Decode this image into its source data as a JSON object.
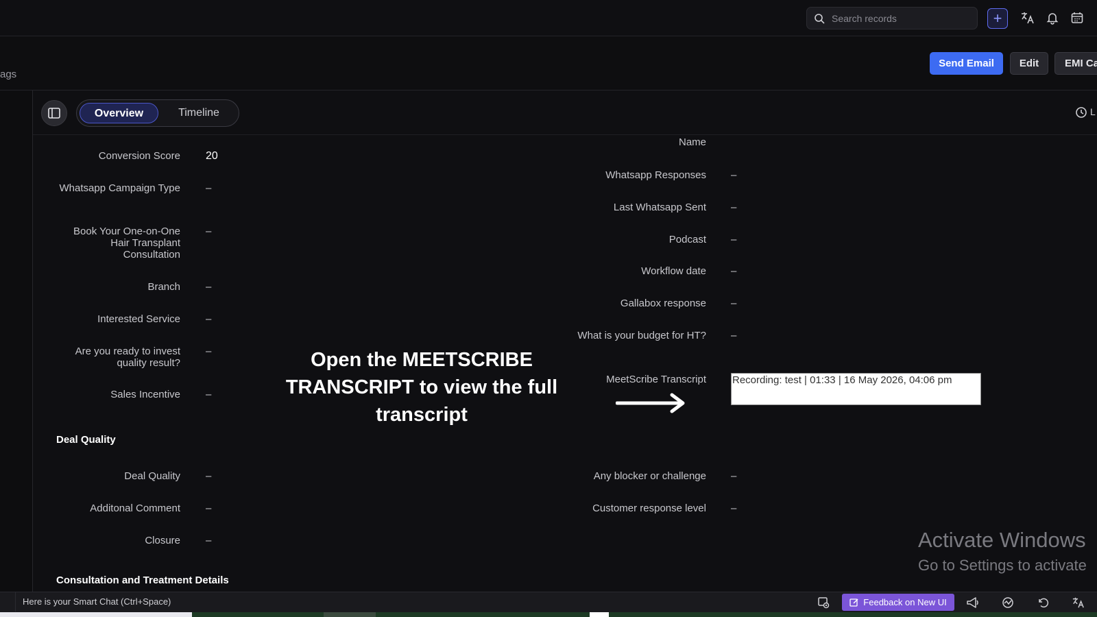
{
  "topbar": {
    "search_placeholder": "Search records",
    "add_label": "+"
  },
  "header": {
    "tags_label": "ags",
    "send_email": "Send Email",
    "edit": "Edit",
    "emi": "EMI Ca"
  },
  "tabs": {
    "overview": "Overview",
    "timeline": "Timeline",
    "clock_label": "L"
  },
  "left_fields": [
    {
      "label": "Conversion Score",
      "value": "20"
    },
    {
      "label": "Whatsapp Campaign Type",
      "value": "–"
    },
    {
      "label": "Book Your One-on-One Hair Transplant Consultation",
      "value": "–"
    },
    {
      "label": "Branch",
      "value": "–"
    },
    {
      "label": "Interested Service",
      "value": "–"
    },
    {
      "label": "Are you ready to invest quality result?",
      "value": "–"
    },
    {
      "label": "Sales Incentive",
      "value": "–"
    }
  ],
  "deal_quality_section": {
    "title": "Deal Quality",
    "fields": [
      {
        "label": "Deal Quality",
        "value": "–"
      },
      {
        "label": "Additonal Comment",
        "value": "–"
      },
      {
        "label": "Closure",
        "value": "–"
      }
    ]
  },
  "consultation_section": {
    "title": "Consultation and Treatment Details"
  },
  "right_fields": {
    "partial_label": "Name",
    "items": [
      {
        "label": "Whatsapp Responses",
        "value": "–"
      },
      {
        "label": "Last Whatsapp Sent",
        "value": "–"
      },
      {
        "label": "Podcast",
        "value": "–"
      },
      {
        "label": "Workflow date",
        "value": "–"
      },
      {
        "label": "Gallabox response",
        "value": "–"
      },
      {
        "label": "What is your budget for HT?",
        "value": "–"
      }
    ],
    "transcript_label": "MeetScribe Transcript",
    "transcript_value": "Recording: test | 01:33 | 16 May 2026, 04:06 pm",
    "lower_items": [
      {
        "label": "Any blocker or challenge",
        "value": "–"
      },
      {
        "label": "Customer response level",
        "value": "–"
      }
    ]
  },
  "annotation": {
    "text": "Open the MEETSCRIBE TRANSCRIPT to view the full transcript"
  },
  "watermark": {
    "line1": "Activate Windows",
    "line2": "Go to Settings to activate"
  },
  "bottombar": {
    "smart_chat": "Here is your Smart Chat (Ctrl+Space)",
    "feedback": "Feedback on New UI"
  },
  "colors": {
    "accent": "#3d6bf2",
    "feedback": "#7b55d8",
    "background": "#0f0f12"
  }
}
